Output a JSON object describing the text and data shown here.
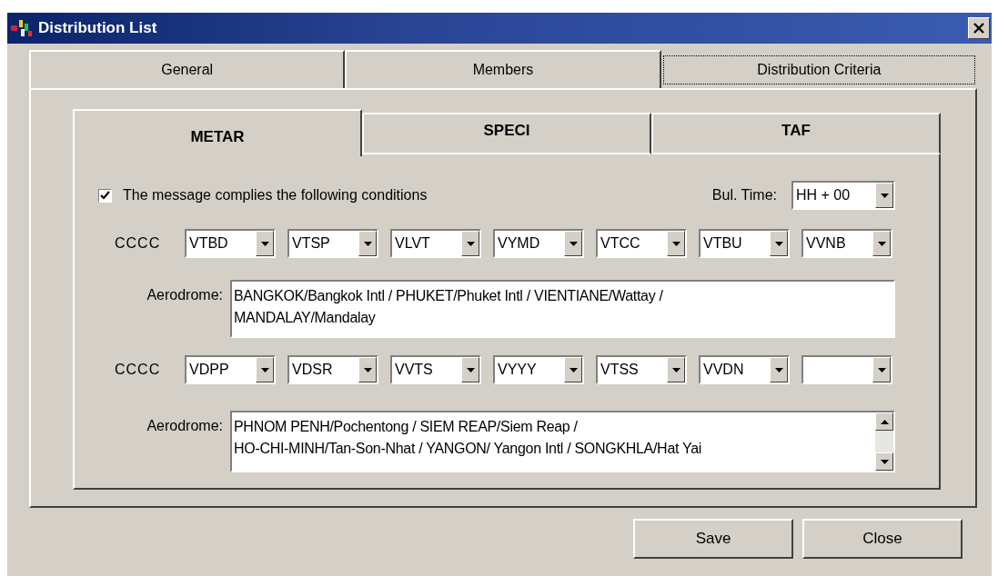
{
  "window": {
    "title": "Distribution List"
  },
  "tabs": [
    {
      "label": "General",
      "selected": false
    },
    {
      "label": "Members",
      "selected": false
    },
    {
      "label": "Distribution Criteria",
      "selected": true
    }
  ],
  "message_tabs": [
    {
      "label": "METAR",
      "selected": true
    },
    {
      "label": "SPECI",
      "selected": false
    },
    {
      "label": "TAF",
      "selected": false
    }
  ],
  "conditions": {
    "label": "The message complies the following conditions",
    "checked": true
  },
  "bul_time": {
    "label": "Bul. Time:",
    "value": "HH + 00"
  },
  "groups": [
    {
      "cccc_label": "CCCC",
      "codes": [
        {
          "kind": "code",
          "value": "VTBD"
        },
        {
          "kind": "code",
          "value": "VTSP"
        },
        {
          "kind": "code",
          "value": "VLVT"
        },
        {
          "kind": "code",
          "value": "VYMD"
        },
        {
          "kind": "code",
          "value": "VTCC"
        },
        {
          "kind": "code",
          "value": "VTBU"
        },
        {
          "kind": "code",
          "value": "VVNB"
        }
      ],
      "aerodrome_label": "Aerodrome:",
      "aerodrome_lines": [
        "BANGKOK/Bangkok Intl / PHUKET/Phuket Intl / VIENTIANE/Wattay /",
        "MANDALAY/Mandalay"
      ],
      "scrollable": false
    },
    {
      "cccc_label": "CCCC",
      "codes": [
        {
          "kind": "code",
          "value": "VDPP"
        },
        {
          "kind": "code",
          "value": "VDSR"
        },
        {
          "kind": "code",
          "value": "VVTS"
        },
        {
          "kind": "code",
          "value": "VYYY"
        },
        {
          "kind": "code",
          "value": "VTSS"
        },
        {
          "kind": "code",
          "value": "VVDN"
        },
        {
          "kind": "blank"
        }
      ],
      "aerodrome_label": "Aerodrome:",
      "aerodrome_lines": [
        "PHNOM PENH/Pochentong / SIEM REAP/Siem Reap /",
        "HO-CHI-MINH/Tan-Son-Nhat / YANGON/ Yangon Intl / SONGKHLA/Hat Yai"
      ],
      "scrollable": true
    }
  ],
  "buttons": [
    {
      "label": "Save"
    },
    {
      "label": "Close"
    }
  ]
}
